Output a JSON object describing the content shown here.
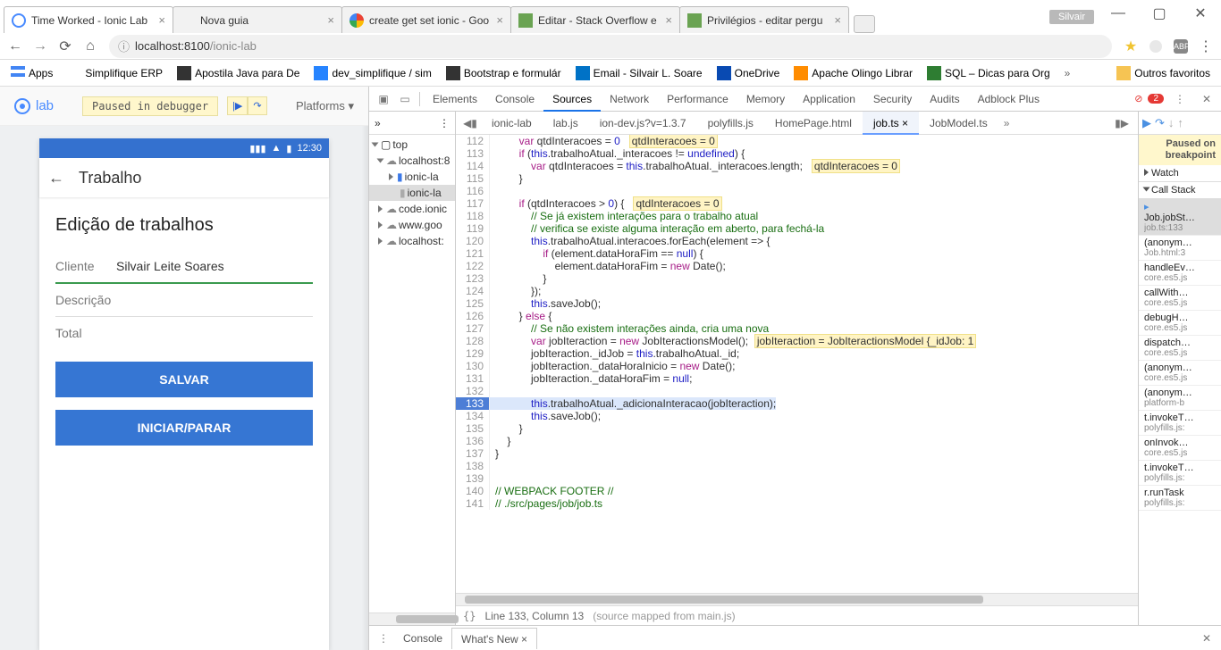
{
  "window": {
    "user": "Silvair",
    "tabs": [
      {
        "title": "Time Worked - Ionic Lab",
        "active": true
      },
      {
        "title": "Nova guia"
      },
      {
        "title": "create get set ionic - Goo"
      },
      {
        "title": "Editar - Stack Overflow e"
      },
      {
        "title": "Privilégios - editar pergu"
      }
    ]
  },
  "address": {
    "host": "localhost",
    "port": ":8100",
    "path": "/ionic-lab"
  },
  "bookmarks": {
    "apps": "Apps",
    "items": [
      "Simplifique ERP",
      "Apostila Java para De",
      "dev_simplifique / sim",
      "Bootstrap e formulár",
      "Email - Silvair L. Soare",
      "OneDrive",
      "Apache Olingo Librar",
      "SQL – Dicas para Org"
    ],
    "overflow": "Outros favoritos"
  },
  "lab": {
    "logo": "lab",
    "paused": "Paused in debugger",
    "platforms": "Platforms",
    "clock": "12:30"
  },
  "app": {
    "title": "Trabalho",
    "heading": "Edição de trabalhos",
    "clienteLabel": "Cliente",
    "clienteValue": "Silvair Leite Soares",
    "descricaoLabel": "Descrição",
    "totalLabel": "Total",
    "btnSalvar": "SALVAR",
    "btnIniciarParar": "INICIAR/PARAR"
  },
  "devtools": {
    "panels": [
      "Elements",
      "Console",
      "Sources",
      "Network",
      "Performance",
      "Memory",
      "Application",
      "Security",
      "Audits",
      "Adblock Plus"
    ],
    "activePanel": "Sources",
    "errorCount": "2",
    "fileTabs": [
      "ionic-lab",
      "lab.js",
      "ion-dev.js?v=1.3.7",
      "polyfills.js",
      "HomePage.html",
      "job.ts",
      "JobModel.ts"
    ],
    "activeFile": "job.ts",
    "tree": {
      "top": "top",
      "localhost": "localhost:8",
      "ionicFolder": "ionic-la",
      "ionicFile": "ionic-la",
      "codeIonic": "code.ionic",
      "google": "www.goo",
      "localhost2": "localhost:"
    },
    "debugger": {
      "banner1": "Paused on",
      "banner2": "breakpoint",
      "watch": "Watch",
      "callstack": "Call Stack",
      "frames": [
        {
          "fn": "Job.jobSt…",
          "loc": "job.ts:133",
          "sel": true
        },
        {
          "fn": "(anonym…",
          "loc": "Job.html:3"
        },
        {
          "fn": "handleEv…",
          "loc": "core.es5.js"
        },
        {
          "fn": "callWith…",
          "loc": "core.es5.js"
        },
        {
          "fn": "debugH…",
          "loc": "core.es5.js"
        },
        {
          "fn": "dispatch…",
          "loc": "core.es5.js"
        },
        {
          "fn": "(anonym…",
          "loc": "core.es5.js"
        },
        {
          "fn": "(anonym…",
          "loc": "platform-b"
        },
        {
          "fn": "t.invokeT…",
          "loc": "polyfills.js:"
        },
        {
          "fn": "onInvok…",
          "loc": "core.es5.js"
        },
        {
          "fn": "t.invokeT…",
          "loc": "polyfills.js:"
        },
        {
          "fn": "r.runTask",
          "loc": "polyfills.js:"
        }
      ]
    },
    "status": {
      "pos": "Line 133, Column 13",
      "mapped": "(source mapped from main.js)"
    },
    "drawerTabs": [
      "Console",
      "What's New"
    ]
  },
  "code": [
    {
      "n": 112,
      "h": "        <span class='kw'>var</span> qtdInteracoes = <span class='num'>0</span>   <span class='hl'>qtdInteracoes = 0</span>"
    },
    {
      "n": 113,
      "h": "        <span class='kw'>if</span> (<span class='this'>this</span>.trabalhoAtual._interacoes != <span class='prop'>undefined</span>) {"
    },
    {
      "n": 114,
      "h": "            <span class='kw'>var</span> qtdInteracoes = <span class='this'>this</span>.trabalhoAtual._interacoes.length;   <span class='hl'>qtdInteracoes = 0</span>"
    },
    {
      "n": 115,
      "h": "        }"
    },
    {
      "n": 116,
      "h": ""
    },
    {
      "n": 117,
      "h": "        <span class='kw'>if</span> (qtdInteracoes &gt; <span class='num'>0</span>) {   <span class='hl'>qtdInteracoes = 0</span>"
    },
    {
      "n": 118,
      "h": "            <span class='cm'>// Se já existem interações para o trabalho atual</span>"
    },
    {
      "n": 119,
      "h": "            <span class='cm'>// verifica se existe alguma interação em aberto, para fechá-la</span>"
    },
    {
      "n": 120,
      "h": "            <span class='this'>this</span>.trabalhoAtual.interacoes.forEach(element =&gt; {"
    },
    {
      "n": 121,
      "h": "                <span class='kw'>if</span> (element.dataHoraFim == <span class='prop'>null</span>) {"
    },
    {
      "n": 122,
      "h": "                    element.dataHoraFim = <span class='kw'>new</span> Date();"
    },
    {
      "n": 123,
      "h": "                }"
    },
    {
      "n": 124,
      "h": "            });"
    },
    {
      "n": 125,
      "h": "            <span class='this'>this</span>.saveJob();"
    },
    {
      "n": 126,
      "h": "        } <span class='kw'>else</span> {"
    },
    {
      "n": 127,
      "h": "            <span class='cm'>// Se não existem interações ainda, cria uma nova</span>"
    },
    {
      "n": 128,
      "h": "            <span class='kw'>var</span> jobIteraction = <span class='kw'>new</span> JobIteractionsModel();  <span class='hl'>jobIteraction = JobIteractionsModel {_idJob: 1</span>"
    },
    {
      "n": 129,
      "h": "            jobIteraction._idJob = <span class='this'>this</span>.trabalhoAtual._id;"
    },
    {
      "n": 130,
      "h": "            jobIteraction._dataHoraInicio = <span class='kw'>new</span> Date();"
    },
    {
      "n": 131,
      "h": "            jobIteraction._dataHoraFim = <span class='prop'>null</span>;"
    },
    {
      "n": 132,
      "h": ""
    },
    {
      "n": 133,
      "h": "            <span class='this'>this</span>.trabalhoAtual._adicionaInteracao(jobIteraction);",
      "cur": true
    },
    {
      "n": 134,
      "h": "            <span class='this'>this</span>.saveJob();"
    },
    {
      "n": 135,
      "h": "        }"
    },
    {
      "n": 136,
      "h": "    }"
    },
    {
      "n": 137,
      "h": "}"
    },
    {
      "n": 138,
      "h": ""
    },
    {
      "n": 139,
      "h": ""
    },
    {
      "n": 140,
      "h": "<span class='cm'>// WEBPACK FOOTER //</span>"
    },
    {
      "n": 141,
      "h": "<span class='cm'>// ./src/pages/job/job.ts</span>"
    }
  ]
}
